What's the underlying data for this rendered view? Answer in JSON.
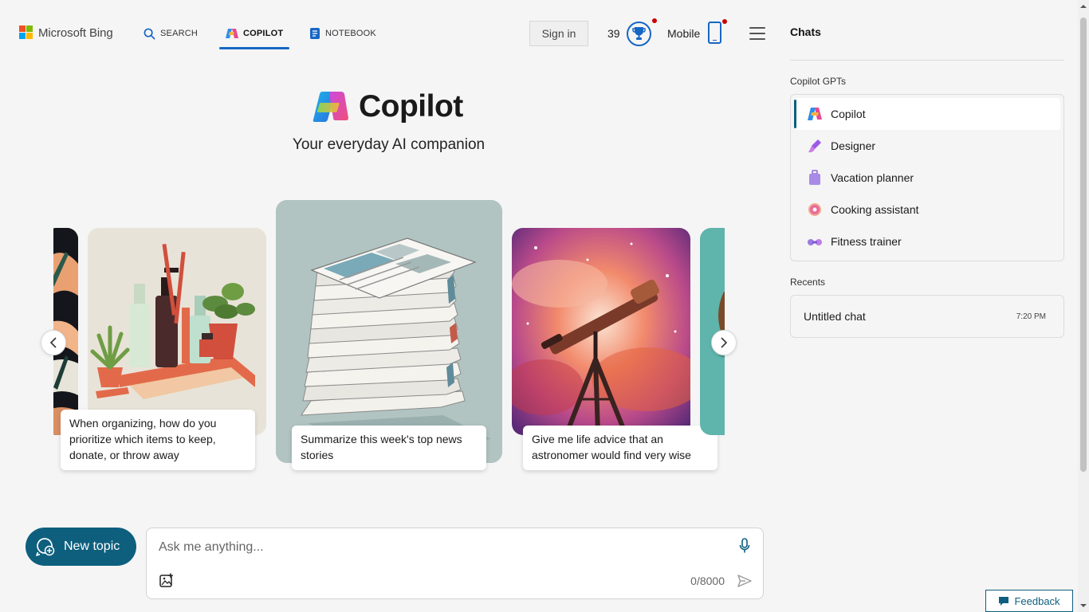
{
  "header": {
    "brand": "Microsoft Bing",
    "tabs": [
      {
        "label": "SEARCH",
        "icon": "search-icon"
      },
      {
        "label": "COPILOT",
        "icon": "copilot-icon",
        "active": true
      },
      {
        "label": "NOTEBOOK",
        "icon": "notebook-icon"
      }
    ],
    "signin_label": "Sign in",
    "points": "39",
    "mobile_label": "Mobile"
  },
  "hero": {
    "title": "Copilot",
    "tagline": "Your everyday AI companion"
  },
  "carousel": {
    "cards": [
      {
        "prompt": "When organizing, how do you prioritize which items to keep, donate, or throw away",
        "image": "toiletries-and-plants-illustration"
      },
      {
        "prompt": "Summarize this week's top news stories",
        "image": "newspaper-stack-illustration"
      },
      {
        "prompt": "Give me life advice that an astronomer would find very wise",
        "image": "telescope-nebula-illustration"
      }
    ]
  },
  "composer": {
    "new_topic_label": "New topic",
    "placeholder": "Ask me anything...",
    "char_count": "0/8000"
  },
  "sidebar": {
    "title": "Chats",
    "gpts_label": "Copilot GPTs",
    "gpts": [
      {
        "label": "Copilot",
        "icon": "copilot-icon",
        "selected": true
      },
      {
        "label": "Designer",
        "icon": "designer-icon"
      },
      {
        "label": "Vacation planner",
        "icon": "suitcase-icon"
      },
      {
        "label": "Cooking assistant",
        "icon": "donut-icon"
      },
      {
        "label": "Fitness trainer",
        "icon": "dumbbell-icon"
      }
    ],
    "recents_label": "Recents",
    "recents": [
      {
        "title": "Untitled chat",
        "time": "7:20 PM"
      }
    ]
  },
  "feedback_label": "Feedback",
  "colors": {
    "accent": "#0e5f7e",
    "nav_active": "#1766c5",
    "notification": "#c80000"
  }
}
